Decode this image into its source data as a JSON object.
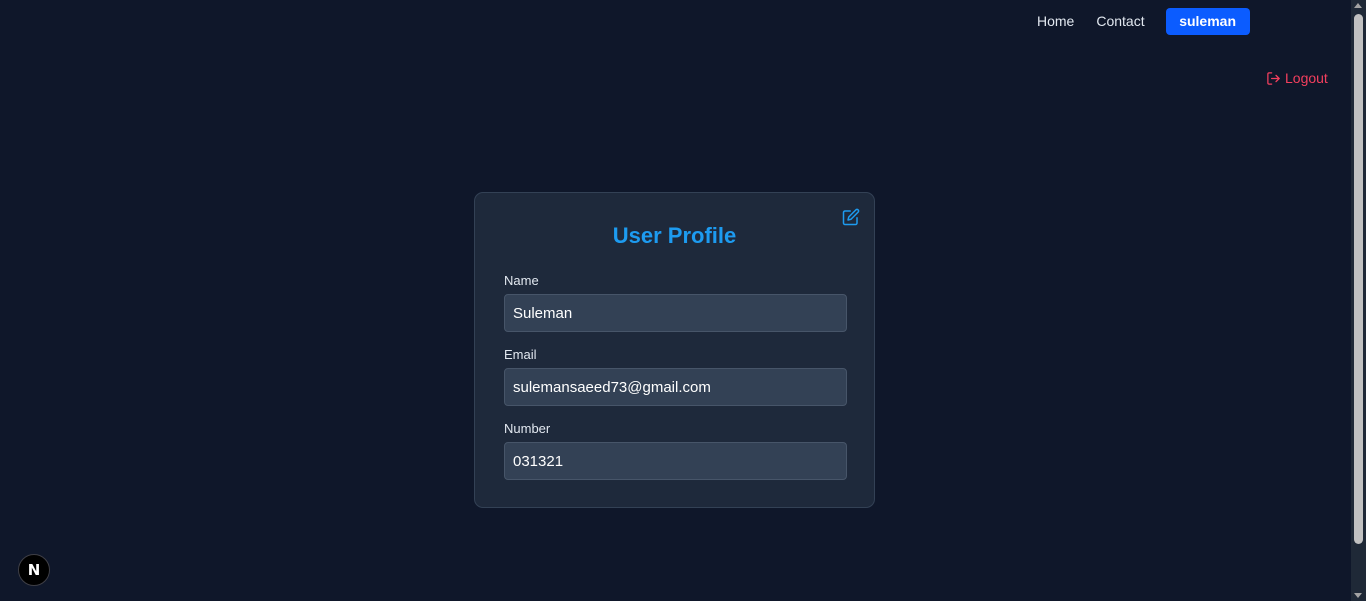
{
  "nav": {
    "home_label": "Home",
    "contact_label": "Contact",
    "user_label": "suleman",
    "user_color": "#0b5cff"
  },
  "logout": {
    "label": "Logout",
    "icon": "logout-icon",
    "color": "#f43f5e"
  },
  "profile": {
    "title": "User Profile",
    "title_color": "#1d9bf0",
    "edit_icon": "edit-icon",
    "fields": [
      {
        "label": "Name",
        "value": "Suleman"
      },
      {
        "label": "Email",
        "value": "sulemansaeed73@gmail.com"
      },
      {
        "label": "Number",
        "value": "031321"
      }
    ]
  },
  "dev_badge": {
    "letter": "N",
    "icon": "nextjs-icon"
  }
}
